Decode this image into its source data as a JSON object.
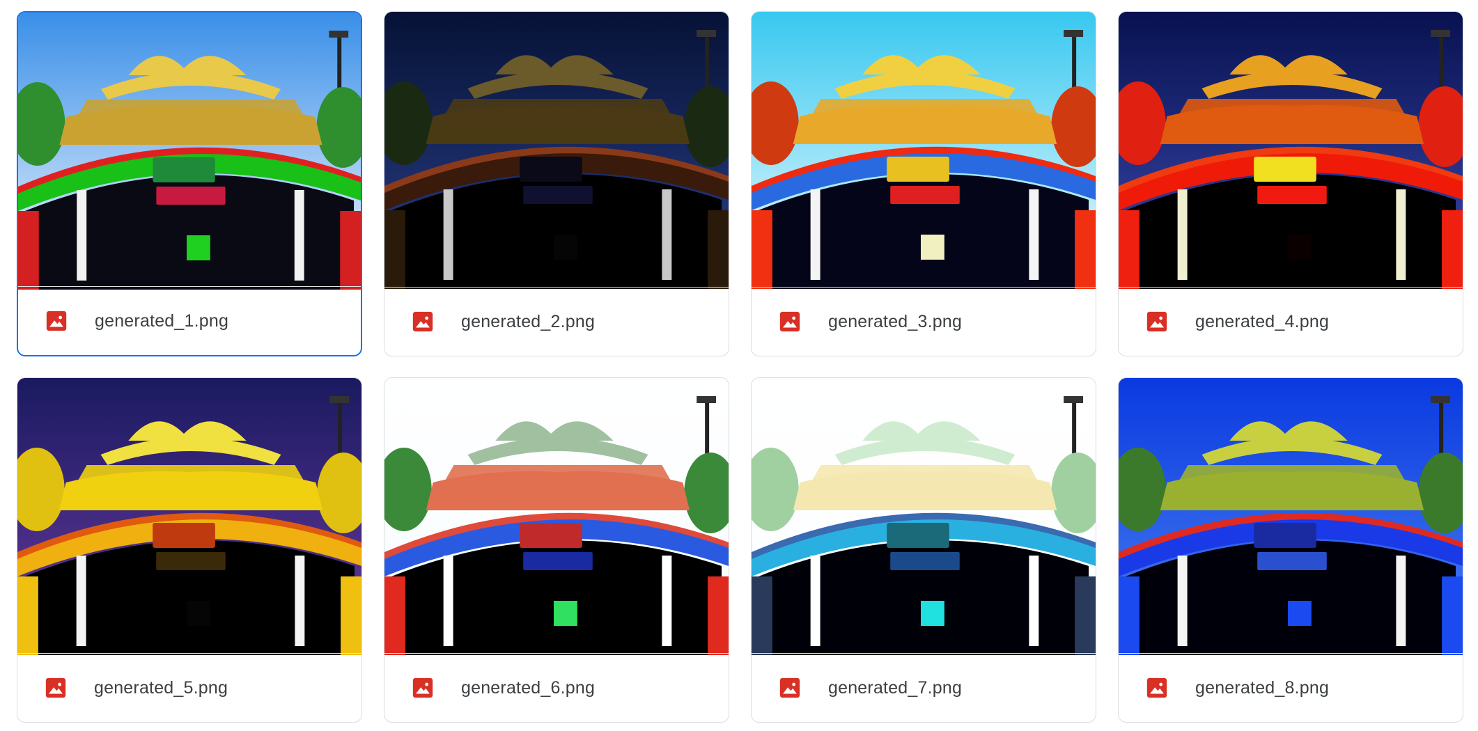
{
  "files": [
    {
      "name": "generated_1.png",
      "icon": "image-file-icon",
      "selected": true,
      "palette": {
        "sky1": "#3a8fe8",
        "sky2": "#f4f8ff",
        "roof": "#c9a232",
        "ornament": "#e8c94a",
        "foliage": "#2f8f2f",
        "arch": "#18c018",
        "archEdge": "#e02020",
        "interior": "#0a0a14",
        "sign": "#1f8a3a",
        "sign2": "#c81a40",
        "pillar": "#f2f2f2",
        "side": "#d42020",
        "door": "#20d020"
      }
    },
    {
      "name": "generated_2.png",
      "icon": "image-file-icon",
      "selected": false,
      "palette": {
        "sky1": "#061236",
        "sky2": "#2a3f8a",
        "roof": "#4a3a14",
        "ornament": "#6b5a2a",
        "foliage": "#1a2a12",
        "arch": "#3a1a0a",
        "archEdge": "#8a3a18",
        "interior": "#000000",
        "sign": "#0a0a18",
        "sign2": "#101030",
        "pillar": "#c8c8c8",
        "side": "#2a1a0a",
        "door": "#050505"
      }
    },
    {
      "name": "generated_3.png",
      "icon": "image-file-icon",
      "selected": false,
      "palette": {
        "sky1": "#38c8f0",
        "sky2": "#f2fcff",
        "roof": "#e8a82a",
        "ornament": "#f0d040",
        "foliage": "#d03a10",
        "arch": "#2a6ae0",
        "archEdge": "#f02a10",
        "interior": "#05051a",
        "sign": "#e8c020",
        "sign2": "#e02020",
        "pillar": "#f4f4f4",
        "side": "#f03010",
        "door": "#f0f0c0"
      }
    },
    {
      "name": "generated_4.png",
      "icon": "image-file-icon",
      "selected": false,
      "palette": {
        "sky1": "#081250",
        "sky2": "#3a4ab0",
        "roof": "#e05a10",
        "ornament": "#e8a020",
        "foliage": "#e02010",
        "arch": "#f01a08",
        "archEdge": "#f03a10",
        "interior": "#000000",
        "sign": "#f0e020",
        "sign2": "#f01a10",
        "pillar": "#f0f0d0",
        "side": "#f02010",
        "door": "#0a0000"
      }
    },
    {
      "name": "generated_5.png",
      "icon": "image-file-icon",
      "selected": false,
      "palette": {
        "sky1": "#1a1a60",
        "sky2": "#6a3aa0",
        "roof": "#f0d010",
        "ornament": "#f0e040",
        "foliage": "#e0c010",
        "arch": "#f0b010",
        "archEdge": "#e05a10",
        "interior": "#000000",
        "sign": "#c03a10",
        "sign2": "#3a2a0a",
        "pillar": "#f4f4f4",
        "side": "#f0c010",
        "door": "#050505"
      }
    },
    {
      "name": "generated_6.png",
      "icon": "image-file-icon",
      "selected": false,
      "palette": {
        "sky1": "#ffffff",
        "sky2": "#f6fcff",
        "roof": "#e07050",
        "ornament": "#a0c0a0",
        "foliage": "#3a8a3a",
        "arch": "#2a5ae0",
        "archEdge": "#e04a3a",
        "interior": "#000000",
        "sign": "#c02a2a",
        "sign2": "#1a2aa0",
        "pillar": "#ffffff",
        "side": "#e02a20",
        "door": "#30e060"
      }
    },
    {
      "name": "generated_7.png",
      "icon": "image-file-icon",
      "selected": false,
      "palette": {
        "sky1": "#ffffff",
        "sky2": "#fbfdff",
        "roof": "#f4e8b0",
        "ornament": "#d0ecd0",
        "foliage": "#a0d0a0",
        "arch": "#2ab0e0",
        "archEdge": "#3a6ab0",
        "interior": "#000008",
        "sign": "#1a6a7a",
        "sign2": "#1a4a8a",
        "pillar": "#ffffff",
        "side": "#2a3a5a",
        "door": "#20e0e0"
      }
    },
    {
      "name": "generated_8.png",
      "icon": "image-file-icon",
      "selected": false,
      "palette": {
        "sky1": "#0a3ae0",
        "sky2": "#4a80f0",
        "roof": "#9ab030",
        "ornament": "#c8d040",
        "foliage": "#3a7a2a",
        "arch": "#1a3ae8",
        "archEdge": "#e02a20",
        "interior": "#00000a",
        "sign": "#1a2aa0",
        "sign2": "#2a50d0",
        "pillar": "#f4f4f4",
        "side": "#1a4af0",
        "door": "#1a4af0"
      }
    }
  ]
}
